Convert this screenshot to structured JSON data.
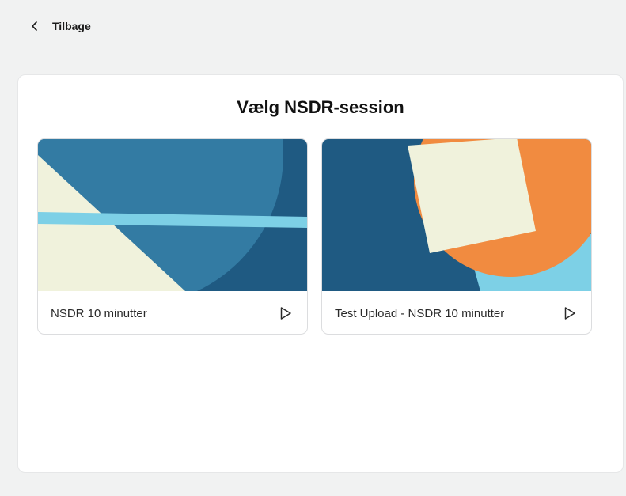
{
  "nav": {
    "back_label": "Tilbage",
    "back_icon": "chevron-left-icon"
  },
  "panel": {
    "title": "Vælg NSDR-session"
  },
  "sessions": [
    {
      "label": "NSDR 10 minutter",
      "action_icon": "play-icon",
      "art_colors": [
        "#1f5a82",
        "#337ba3",
        "#f0f2dc",
        "#7dd0e6"
      ]
    },
    {
      "label": "Test Upload - NSDR 10 minutter",
      "action_icon": "play-icon",
      "art_colors": [
        "#1f5a82",
        "#f18b40",
        "#f0f2dc",
        "#7dd0e6"
      ]
    }
  ]
}
